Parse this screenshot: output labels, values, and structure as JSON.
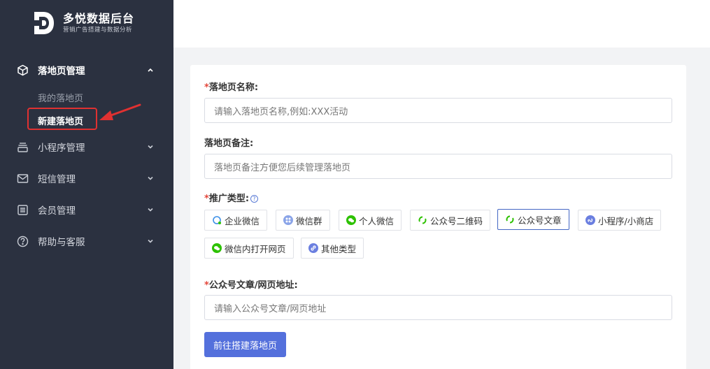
{
  "brand": {
    "title": "多悦数据后台",
    "subtitle": "营销广告搭建与数据分析"
  },
  "sidebar": {
    "groups": [
      {
        "label": "落地页管理",
        "icon": "cube-icon",
        "expanded": true,
        "children": [
          {
            "label": "我的落地页"
          },
          {
            "label": "新建落地页",
            "active": true
          }
        ]
      },
      {
        "label": "小程序管理",
        "icon": "stack-icon"
      },
      {
        "label": "短信管理",
        "icon": "mail-icon"
      },
      {
        "label": "会员管理",
        "icon": "list-icon"
      },
      {
        "label": "帮助与客服",
        "icon": "help-circle-icon"
      }
    ]
  },
  "form": {
    "name": {
      "label": "落地页名称:",
      "placeholder": "请输入落地页名称,例如:XXX活动"
    },
    "remark": {
      "label": "落地页备注:",
      "placeholder": "落地页备注方便您后续管理落地页"
    },
    "type": {
      "label": "推广类型:",
      "help": "?",
      "options": [
        {
          "label": "企业微信",
          "icon": "wecom-icon"
        },
        {
          "label": "微信群",
          "icon": "wechat-group-icon"
        },
        {
          "label": "个人微信",
          "icon": "wechat-icon"
        },
        {
          "label": "公众号二维码",
          "icon": "official-account-icon"
        },
        {
          "label": "公众号文章",
          "icon": "official-account-icon",
          "selected": true
        },
        {
          "label": "小程序/小商店",
          "icon": "mini-program-icon"
        },
        {
          "label": "微信内打开网页",
          "icon": "wechat-icon"
        },
        {
          "label": "其他类型",
          "icon": "link-icon"
        }
      ]
    },
    "url": {
      "label": "公众号文章/网页地址:",
      "placeholder": "请输入公众号文章/网页地址"
    },
    "submit_label": "前往搭建落地页"
  },
  "colors": {
    "sidebar_bg": "#2b3140",
    "primary": "#5470dc",
    "required": "#e4463a",
    "annotation": "#e03131",
    "wechat_green": "#2dc100"
  }
}
